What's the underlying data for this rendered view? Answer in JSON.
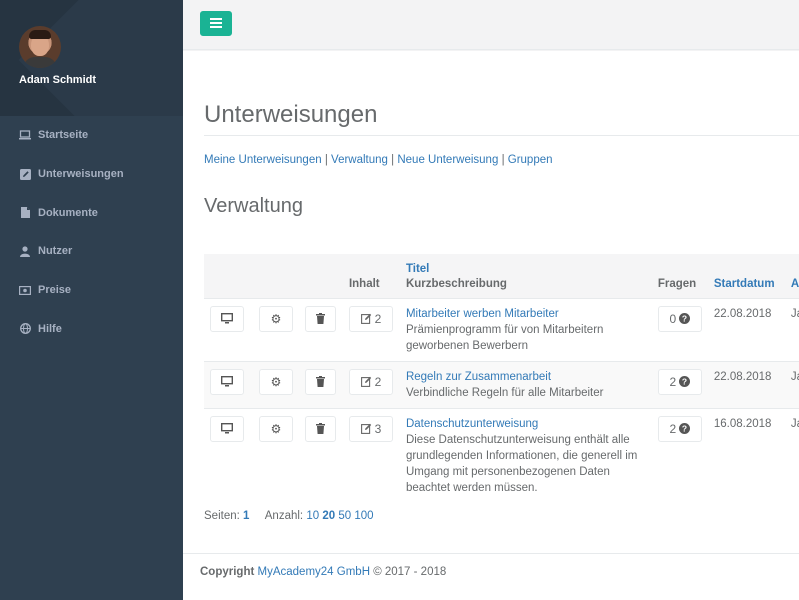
{
  "user": {
    "name": "Adam Schmidt"
  },
  "sidebar": {
    "items": [
      {
        "label": "Startseite",
        "icon": "laptop-icon"
      },
      {
        "label": "Unterweisungen",
        "icon": "edit-icon"
      },
      {
        "label": "Dokumente",
        "icon": "file-icon"
      },
      {
        "label": "Nutzer",
        "icon": "user-icon"
      },
      {
        "label": "Preise",
        "icon": "money-icon"
      },
      {
        "label": "Hilfe",
        "icon": "globe-icon"
      }
    ]
  },
  "page": {
    "title": "Unterweisungen",
    "section_title": "Verwaltung"
  },
  "subnav": {
    "links": [
      "Meine Unterweisungen",
      "Verwaltung",
      "Neue Unterweisung",
      "Gruppen"
    ],
    "separator": "|"
  },
  "table": {
    "headers": {
      "inhalt": "Inhalt",
      "titel": "Titel",
      "kurzbeschreibung": "Kurzbeschreibung",
      "fragen": "Fragen",
      "startdatum": "Startdatum",
      "next": "A"
    },
    "rows": [
      {
        "title": "Mitarbeiter werben Mitarbeiter",
        "description": "Prämienprogramm für von Mitarbeitern geworbenen Bewerbern",
        "content_count": "2",
        "questions": "0",
        "start_date": "22.08.2018",
        "next": "Ja"
      },
      {
        "title": "Regeln zur Zusammenarbeit",
        "description": "Verbindliche Regeln für alle Mitarbeiter",
        "content_count": "2",
        "questions": "2",
        "start_date": "22.08.2018",
        "next": "Ja"
      },
      {
        "title": "Datenschutzunterweisung",
        "description": "Diese Datenschutzunterweisung enthält alle grundlegenden Informationen, die generell im Umgang mit personenbezogenen Daten beachtet werden müssen.",
        "content_count": "3",
        "questions": "2",
        "start_date": "16.08.2018",
        "next": "Ja"
      }
    ]
  },
  "pager": {
    "pages_label": "Seiten:",
    "current_page": "1",
    "count_label": "Anzahl:",
    "options": [
      "10",
      "20",
      "50",
      "100"
    ],
    "selected": "20"
  },
  "footer": {
    "copyright_label": "Copyright",
    "company": "MyAcademy24 GmbH",
    "years": "© 2017 - 2018"
  },
  "colors": {
    "accent": "#1ab394",
    "sidebar": "#2f4050",
    "link": "#337ab7"
  }
}
